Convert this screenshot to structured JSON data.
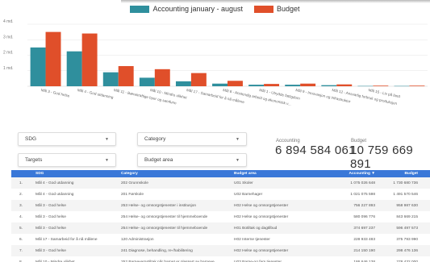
{
  "legend": {
    "accounting_label": "Accounting january - august",
    "budget_label": "Budget",
    "accounting_color": "#2f8f9d",
    "budget_color": "#e04f2a"
  },
  "chart_data": {
    "type": "bar",
    "title": "",
    "xlabel": "",
    "ylabel": "",
    "ylim": [
      0,
      4
    ],
    "yticks": [
      "1 md.",
      "2 md.",
      "3 md.",
      "4 md."
    ],
    "categories": [
      "Mål 3 - God helse",
      "Mål 4 - God utdanning",
      "Mål 11 - Bærekraftige byer og samfunn",
      "Mål 10 - Mindre ulikhet",
      "Mål 17 - Samarbeid for å nå målene",
      "Mål 8 - Anstendig arbeid og økonomisk v...",
      "Mål 9 - Industri, innovasjon og infrastruktur",
      "Mål 6 - Rent vann og gode sanitærforhold",
      "Mål 13 - Stoppe klimaendringene",
      "Mål 12 - Ansvarlig forbruk og produksjon",
      "Mål 15 - Liv på land"
    ],
    "categories_visible": [
      "Mål 3 - God helse",
      "Mål 4 - God utdanning",
      "Mål 11 - Bærekraftige byer og samfunn",
      "Mål 10 - Mindre ulikhet",
      "Mål 17 - Samarbeid for å nå målene",
      "Mål 8 - Anstendig arbeid og økonomisk v...",
      "Mål 1 - Utrydde fattigdom",
      "Mål 9 - Innovasjon og infrastruktur",
      "Mål 12 - Ansvarlig forbruk og produksjon",
      "Mål 15 - Liv på land"
    ],
    "series": [
      {
        "name": "Accounting january - august",
        "values": [
          2.5,
          2.25,
          0.9,
          0.55,
          0.32,
          0.17,
          0.1,
          0.1,
          0.07,
          0.02,
          0.02
        ]
      },
      {
        "name": "Budget",
        "values": [
          3.5,
          3.4,
          1.3,
          1.1,
          0.85,
          0.35,
          0.15,
          0.17,
          0.12,
          0.04,
          0.04
        ]
      }
    ]
  },
  "filters": {
    "sdg": "SDG",
    "category": "Category",
    "targets": "Targets",
    "budget_area": "Budget area"
  },
  "kpi": {
    "accounting_label": "Accounting",
    "accounting_value": "6 894 584 061",
    "budget_label": "Budget",
    "budget_value": "10 759 669 891"
  },
  "table": {
    "headers": [
      "SDG",
      "Category",
      "Budget area",
      "Accounting ▼",
      "Budget"
    ],
    "rows": [
      [
        "1.",
        "Mål 4 - God utdanning",
        "202 Grunnskole",
        "U01 Skoler",
        "1 075 026 648",
        "1 730 680 736"
      ],
      [
        "2.",
        "Mål 4 - God utdanning",
        "201 Førskole",
        "U02 Barnehager",
        "1 021 075 598",
        "1 491 570 546"
      ],
      [
        "3.",
        "Mål 3 - God helse",
        "253 Helse- og omsorgstjenester i institusjon",
        "H02 Helse og omsorgstjenester",
        "756 227 893",
        "958 987 630"
      ],
      [
        "4.",
        "Mål 3 - God helse",
        "254 Helse- og omsorgstjenester til hjemmeboende",
        "H02 Helse og omsorgstjenester",
        "580 096 776",
        "843 669 215"
      ],
      [
        "5.",
        "Mål 3 - God helse",
        "254 Helse- og omsorgstjenester til hjemmeboende",
        "H01 Botiltak og dagtilbud",
        "374 697 237",
        "596 497 573"
      ],
      [
        "6.",
        "Mål 17 - Samarbeid for å nå målene",
        "120 Administrasjon",
        "H02 Interne tjenester",
        "228 933 483",
        "375 793 990"
      ],
      [
        "7.",
        "Mål 3 - God helse",
        "241 Diagnose, behandling, re-/habilitering",
        "H02 Helse og omsorgstjenester",
        "214 150 190",
        "298 476 136"
      ],
      [
        "8.",
        "Mål 10 - Mindre ulikhet",
        "252 Barnevernstiltak når barnet er plassert av barneve...",
        "U03 Barne-og fam.tjenester",
        "186 646 138",
        "278 432 000"
      ]
    ]
  }
}
